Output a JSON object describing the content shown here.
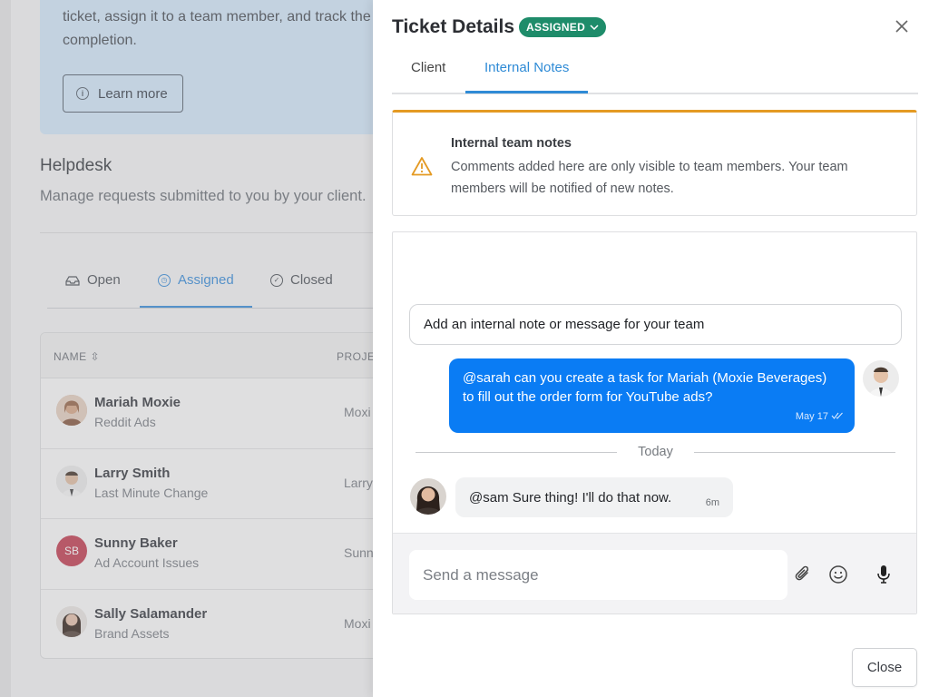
{
  "background": {
    "banner": {
      "text": "ticket, assign it to a team member, and track the completion.",
      "learn_more": "Learn more"
    },
    "helpdesk": {
      "title": "Helpdesk",
      "subtitle": "Manage requests submitted to you by your client."
    },
    "tabs": [
      {
        "label": "Open"
      },
      {
        "label": "Assigned"
      },
      {
        "label": "Closed"
      }
    ],
    "table": {
      "columns": [
        "NAME",
        "PROJE"
      ],
      "rows": [
        {
          "name": "Mariah Moxie",
          "sub": "Reddit Ads",
          "project": "Moxi"
        },
        {
          "name": "Larry Smith",
          "sub": "Last Minute Change",
          "project": "Larry"
        },
        {
          "name": "Sunny Baker",
          "sub": "Ad Account Issues",
          "project": "Sunn",
          "initials": "SB"
        },
        {
          "name": "Sally Salamander",
          "sub": "Brand Assets",
          "project": "Moxi"
        }
      ]
    }
  },
  "drawer": {
    "title": "Ticket Details",
    "status": "ASSIGNED",
    "tabs": [
      {
        "label": "Client"
      },
      {
        "label": "Internal Notes"
      }
    ],
    "notice": {
      "title": "Internal team notes",
      "body": "Comments added here are only visible to team members. Your team members will be notified of new notes."
    },
    "note_input": "Add an internal note or message for your team",
    "messages": {
      "outgoing": {
        "text": "@sarah can you create a task for Mariah (Moxie Beverages) to fill out the order form for YouTube ads?",
        "time": "May 17"
      },
      "separator": "Today",
      "incoming": {
        "text": "@sam Sure thing! I'll do that now.",
        "time": "6m"
      }
    },
    "composer": {
      "placeholder": "Send a message"
    },
    "close_button": "Close"
  },
  "colors": {
    "accent": "#2f8bd6",
    "status_badge": "#1e8c6a",
    "outgoing_bubble": "#0a7cf4",
    "warning": "#e49a23",
    "avatar_sb": "#c44255"
  }
}
